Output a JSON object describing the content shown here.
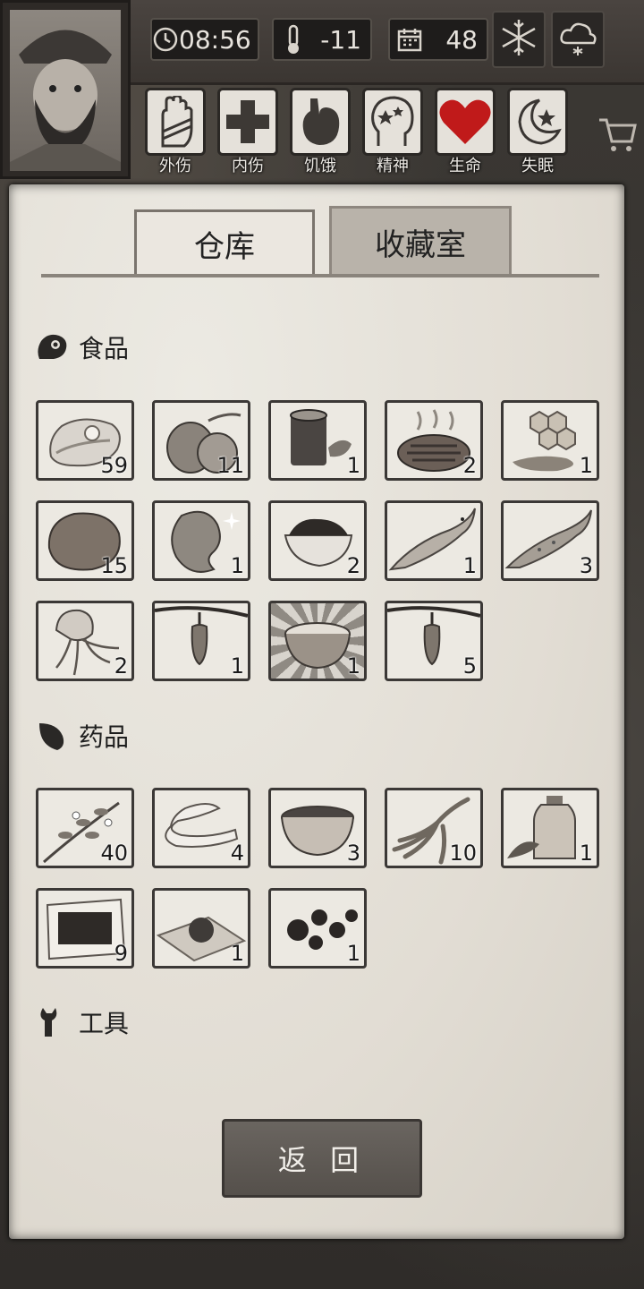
{
  "hud": {
    "time": "08:56",
    "temperature": "-11",
    "day": "48",
    "status": [
      {
        "label": "外伤",
        "icon": "bandaged-hand-icon"
      },
      {
        "label": "内伤",
        "icon": "medical-cross-icon"
      },
      {
        "label": "饥饿",
        "icon": "stomach-icon"
      },
      {
        "label": "精神",
        "icon": "head-stars-icon"
      },
      {
        "label": "生命",
        "icon": "heart-icon",
        "color": "#c01a1a"
      },
      {
        "label": "失眠",
        "icon": "moon-star-icon"
      }
    ]
  },
  "tabs": {
    "storage": "仓库",
    "collection": "收藏室"
  },
  "sections": {
    "food": {
      "title": "食品",
      "items": [
        {
          "icon": "raw-meat-icon",
          "count": "59"
        },
        {
          "icon": "coconut-icon",
          "count": "11"
        },
        {
          "icon": "tea-tin-icon",
          "count": "1"
        },
        {
          "icon": "cooked-steak-icon",
          "count": "2"
        },
        {
          "icon": "honeycomb-icon",
          "count": "1"
        },
        {
          "icon": "potato-icon",
          "count": "15"
        },
        {
          "icon": "bean-icon",
          "count": "1"
        },
        {
          "icon": "rice-bowl-icon",
          "count": "2"
        },
        {
          "icon": "salmon-icon",
          "count": "1"
        },
        {
          "icon": "trout-icon",
          "count": "3"
        },
        {
          "icon": "jellyfish-icon",
          "count": "2"
        },
        {
          "icon": "hanging-fruit-icon",
          "count": "1"
        },
        {
          "icon": "wooden-bowl-icon",
          "count": "1"
        },
        {
          "icon": "hanging-fruit-icon",
          "count": "5"
        }
      ]
    },
    "medicine": {
      "title": "药品",
      "items": [
        {
          "icon": "herb-branch-icon",
          "count": "40"
        },
        {
          "icon": "bandage-strip-icon",
          "count": "4"
        },
        {
          "icon": "medicine-bowl-icon",
          "count": "3"
        },
        {
          "icon": "ginseng-root-icon",
          "count": "10"
        },
        {
          "icon": "herbal-bottle-icon",
          "count": "1"
        },
        {
          "icon": "plaster-patch-icon",
          "count": "9"
        },
        {
          "icon": "pill-on-paper-icon",
          "count": "1"
        },
        {
          "icon": "pills-icon",
          "count": "1"
        }
      ]
    },
    "tools": {
      "title": "工具"
    }
  },
  "return_label": "返 回"
}
